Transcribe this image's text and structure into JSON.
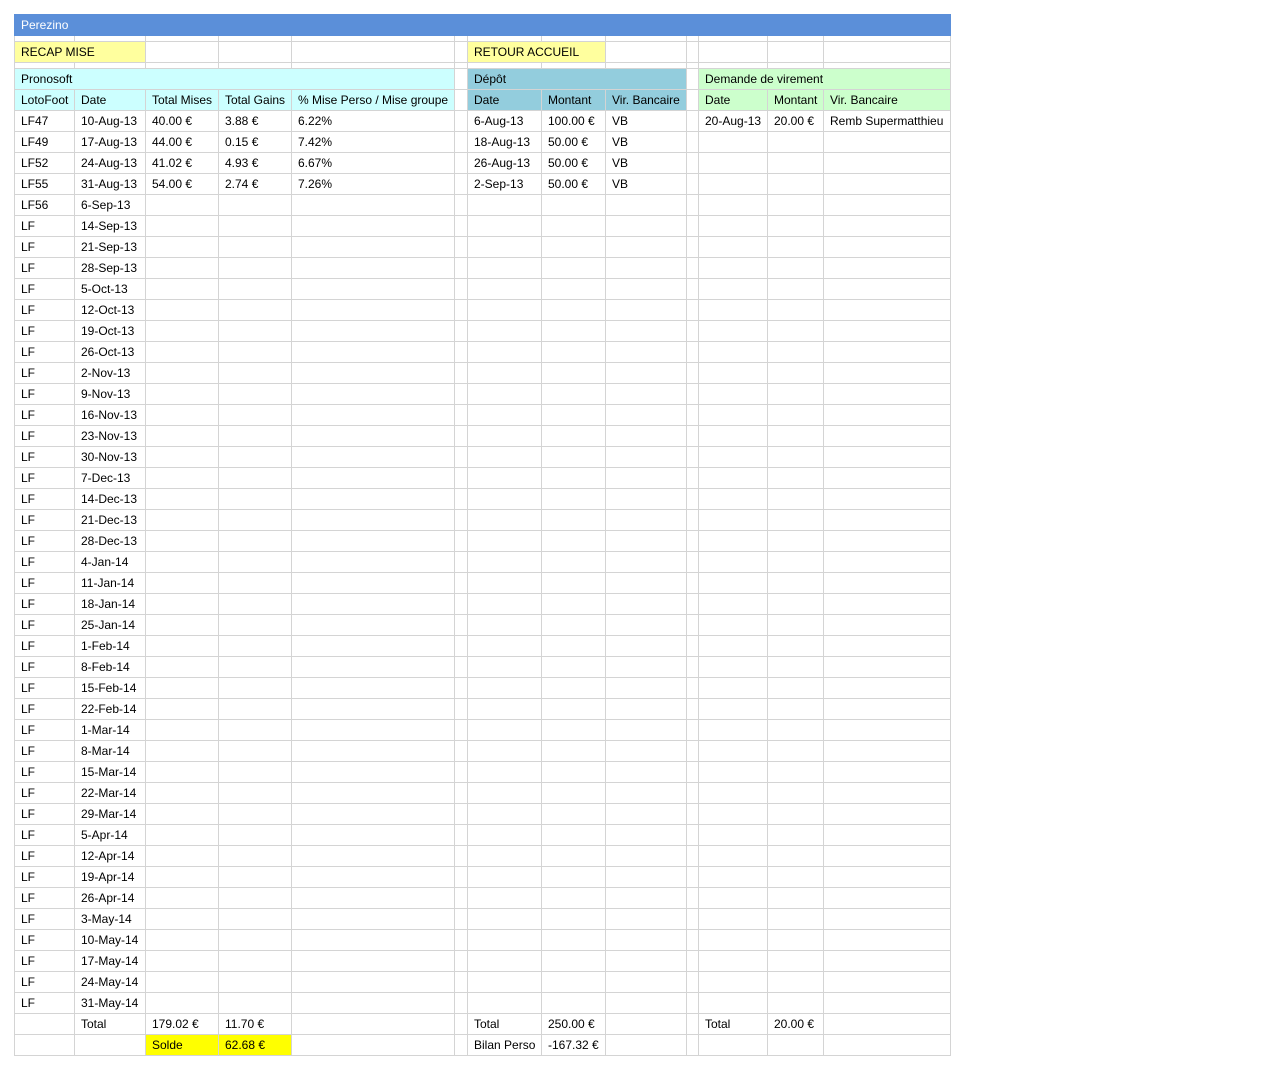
{
  "title": "Perezino",
  "links": {
    "recap": "RECAP MISE",
    "retour": "RETOUR ACCUEIL"
  },
  "sections": {
    "pronosoft": "Pronosoft",
    "depot": "Dépôt",
    "virement": "Demande de virement"
  },
  "headers": {
    "pronosoft": [
      "LotoFoot",
      "Date",
      "Total Mises",
      "Total Gains",
      "% Mise Perso / Mise groupe"
    ],
    "depot": [
      "Date",
      "Montant",
      "Vir. Bancaire"
    ],
    "virement": [
      "Date",
      "Montant",
      "Vir. Bancaire"
    ]
  },
  "pronosoft_rows": [
    [
      "LF47",
      "10-Aug-13",
      "40.00 €",
      "3.88 €",
      "6.22%"
    ],
    [
      "LF49",
      "17-Aug-13",
      "44.00 €",
      "0.15 €",
      "7.42%"
    ],
    [
      "LF52",
      "24-Aug-13",
      "41.02 €",
      "4.93 €",
      "6.67%"
    ],
    [
      "LF55",
      "31-Aug-13",
      "54.00 €",
      "2.74 €",
      "7.26%"
    ],
    [
      "LF56",
      "6-Sep-13",
      "",
      "",
      ""
    ],
    [
      "LF",
      "14-Sep-13",
      "",
      "",
      ""
    ],
    [
      "LF",
      "21-Sep-13",
      "",
      "",
      ""
    ],
    [
      "LF",
      "28-Sep-13",
      "",
      "",
      ""
    ],
    [
      "LF",
      "5-Oct-13",
      "",
      "",
      ""
    ],
    [
      "LF",
      "12-Oct-13",
      "",
      "",
      ""
    ],
    [
      "LF",
      "19-Oct-13",
      "",
      "",
      ""
    ],
    [
      "LF",
      "26-Oct-13",
      "",
      "",
      ""
    ],
    [
      "LF",
      "2-Nov-13",
      "",
      "",
      ""
    ],
    [
      "LF",
      "9-Nov-13",
      "",
      "",
      ""
    ],
    [
      "LF",
      "16-Nov-13",
      "",
      "",
      ""
    ],
    [
      "LF",
      "23-Nov-13",
      "",
      "",
      ""
    ],
    [
      "LF",
      "30-Nov-13",
      "",
      "",
      ""
    ],
    [
      "LF",
      "7-Dec-13",
      "",
      "",
      ""
    ],
    [
      "LF",
      "14-Dec-13",
      "",
      "",
      ""
    ],
    [
      "LF",
      "21-Dec-13",
      "",
      "",
      ""
    ],
    [
      "LF",
      "28-Dec-13",
      "",
      "",
      ""
    ],
    [
      "LF",
      "4-Jan-14",
      "",
      "",
      ""
    ],
    [
      "LF",
      "11-Jan-14",
      "",
      "",
      ""
    ],
    [
      "LF",
      "18-Jan-14",
      "",
      "",
      ""
    ],
    [
      "LF",
      "25-Jan-14",
      "",
      "",
      ""
    ],
    [
      "LF",
      "1-Feb-14",
      "",
      "",
      ""
    ],
    [
      "LF",
      "8-Feb-14",
      "",
      "",
      ""
    ],
    [
      "LF",
      "15-Feb-14",
      "",
      "",
      ""
    ],
    [
      "LF",
      "22-Feb-14",
      "",
      "",
      ""
    ],
    [
      "LF",
      "1-Mar-14",
      "",
      "",
      ""
    ],
    [
      "LF",
      "8-Mar-14",
      "",
      "",
      ""
    ],
    [
      "LF",
      "15-Mar-14",
      "",
      "",
      ""
    ],
    [
      "LF",
      "22-Mar-14",
      "",
      "",
      ""
    ],
    [
      "LF",
      "29-Mar-14",
      "",
      "",
      ""
    ],
    [
      "LF",
      "5-Apr-14",
      "",
      "",
      ""
    ],
    [
      "LF",
      "12-Apr-14",
      "",
      "",
      ""
    ],
    [
      "LF",
      "19-Apr-14",
      "",
      "",
      ""
    ],
    [
      "LF",
      "26-Apr-14",
      "",
      "",
      ""
    ],
    [
      "LF",
      "3-May-14",
      "",
      "",
      ""
    ],
    [
      "LF",
      "10-May-14",
      "",
      "",
      ""
    ],
    [
      "LF",
      "17-May-14",
      "",
      "",
      ""
    ],
    [
      "LF",
      "24-May-14",
      "",
      "",
      ""
    ],
    [
      "LF",
      "31-May-14",
      "",
      "",
      ""
    ]
  ],
  "depot_rows": [
    [
      "6-Aug-13",
      "100.00 €",
      "VB"
    ],
    [
      "18-Aug-13",
      "50.00 €",
      "VB"
    ],
    [
      "26-Aug-13",
      "50.00 €",
      "VB"
    ],
    [
      "2-Sep-13",
      "50.00 €",
      "VB"
    ]
  ],
  "virement_rows": [
    [
      "20-Aug-13",
      "20.00 €",
      "Remb Supermatthieu"
    ]
  ],
  "totals": {
    "label": "Total",
    "total_mises": "179.02 €",
    "total_gains": "11.70 €",
    "depot_total": "250.00 €",
    "virement_total": "20.00 €",
    "solde_label": "Solde",
    "solde_value": "62.68 €",
    "bilan_label": "Bilan Perso",
    "bilan_value": "-167.32 €"
  },
  "colors": {
    "title_bar": "#5b8fd9",
    "link_yellow": "#ffff9e",
    "pronosoft_cyan": "#ccffff",
    "depot_blue": "#93cddd",
    "virement_green": "#ccffcc",
    "solde_yellow": "#ffff00"
  }
}
